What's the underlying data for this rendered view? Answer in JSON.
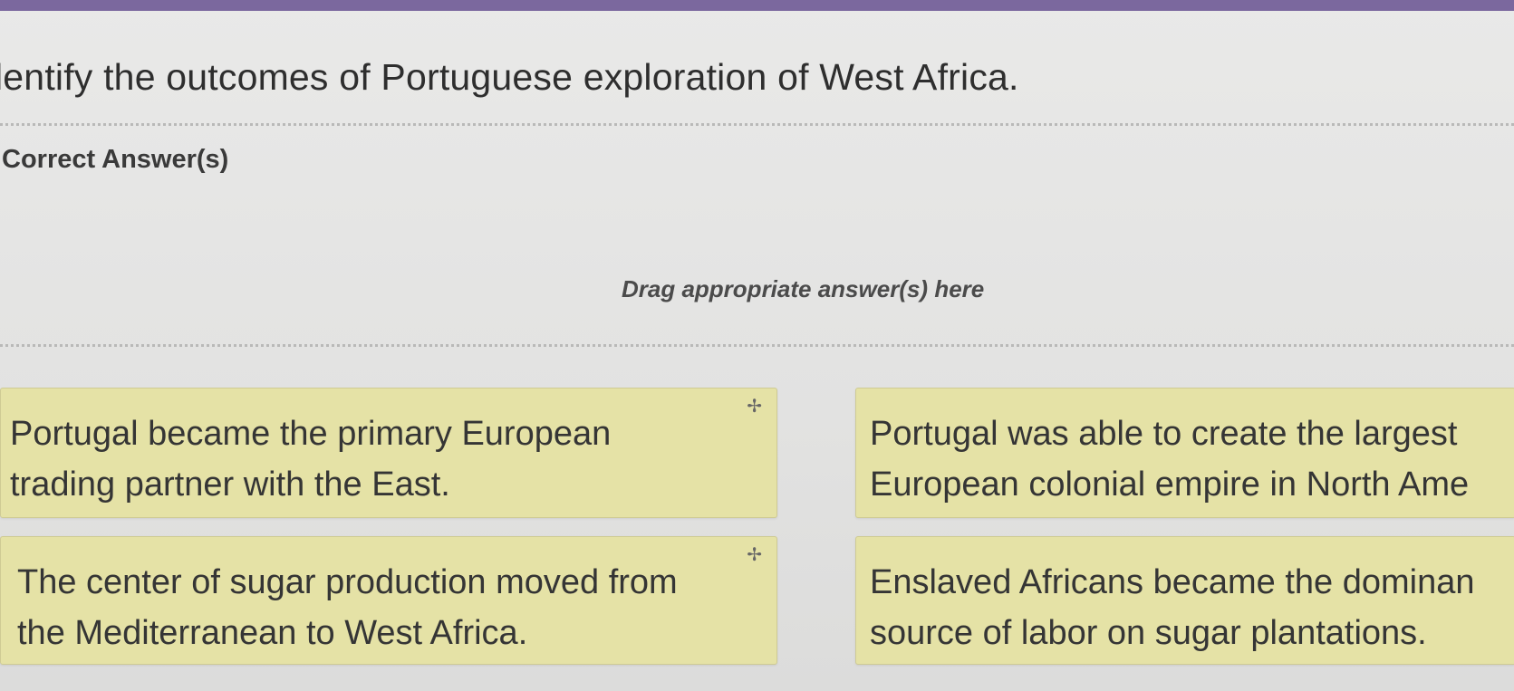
{
  "question": {
    "text": "lentify the outcomes of Portuguese exploration of West Africa."
  },
  "answer_area": {
    "label": "Correct Answer(s)",
    "drop_hint": "Drag appropriate answer(s) here"
  },
  "options": [
    {
      "line1": "Portugal became the primary European",
      "line2": "trading partner with the East.",
      "move_icon": "move-icon"
    },
    {
      "line1": "Portugal was able to create the largest",
      "line2": "European colonial empire in North Ame",
      "move_icon": "move-icon"
    },
    {
      "line1": "The center of sugar production moved from",
      "line2": "the Mediterranean to West Africa.",
      "move_icon": "move-icon"
    },
    {
      "line1": "Enslaved Africans became the dominan",
      "line2": "source of labor on sugar plantations.",
      "move_icon": "move-icon"
    }
  ],
  "colors": {
    "top_bar": "#7b689e",
    "card_background": "#e5e2a6",
    "page_background": "#e4e4e3"
  }
}
